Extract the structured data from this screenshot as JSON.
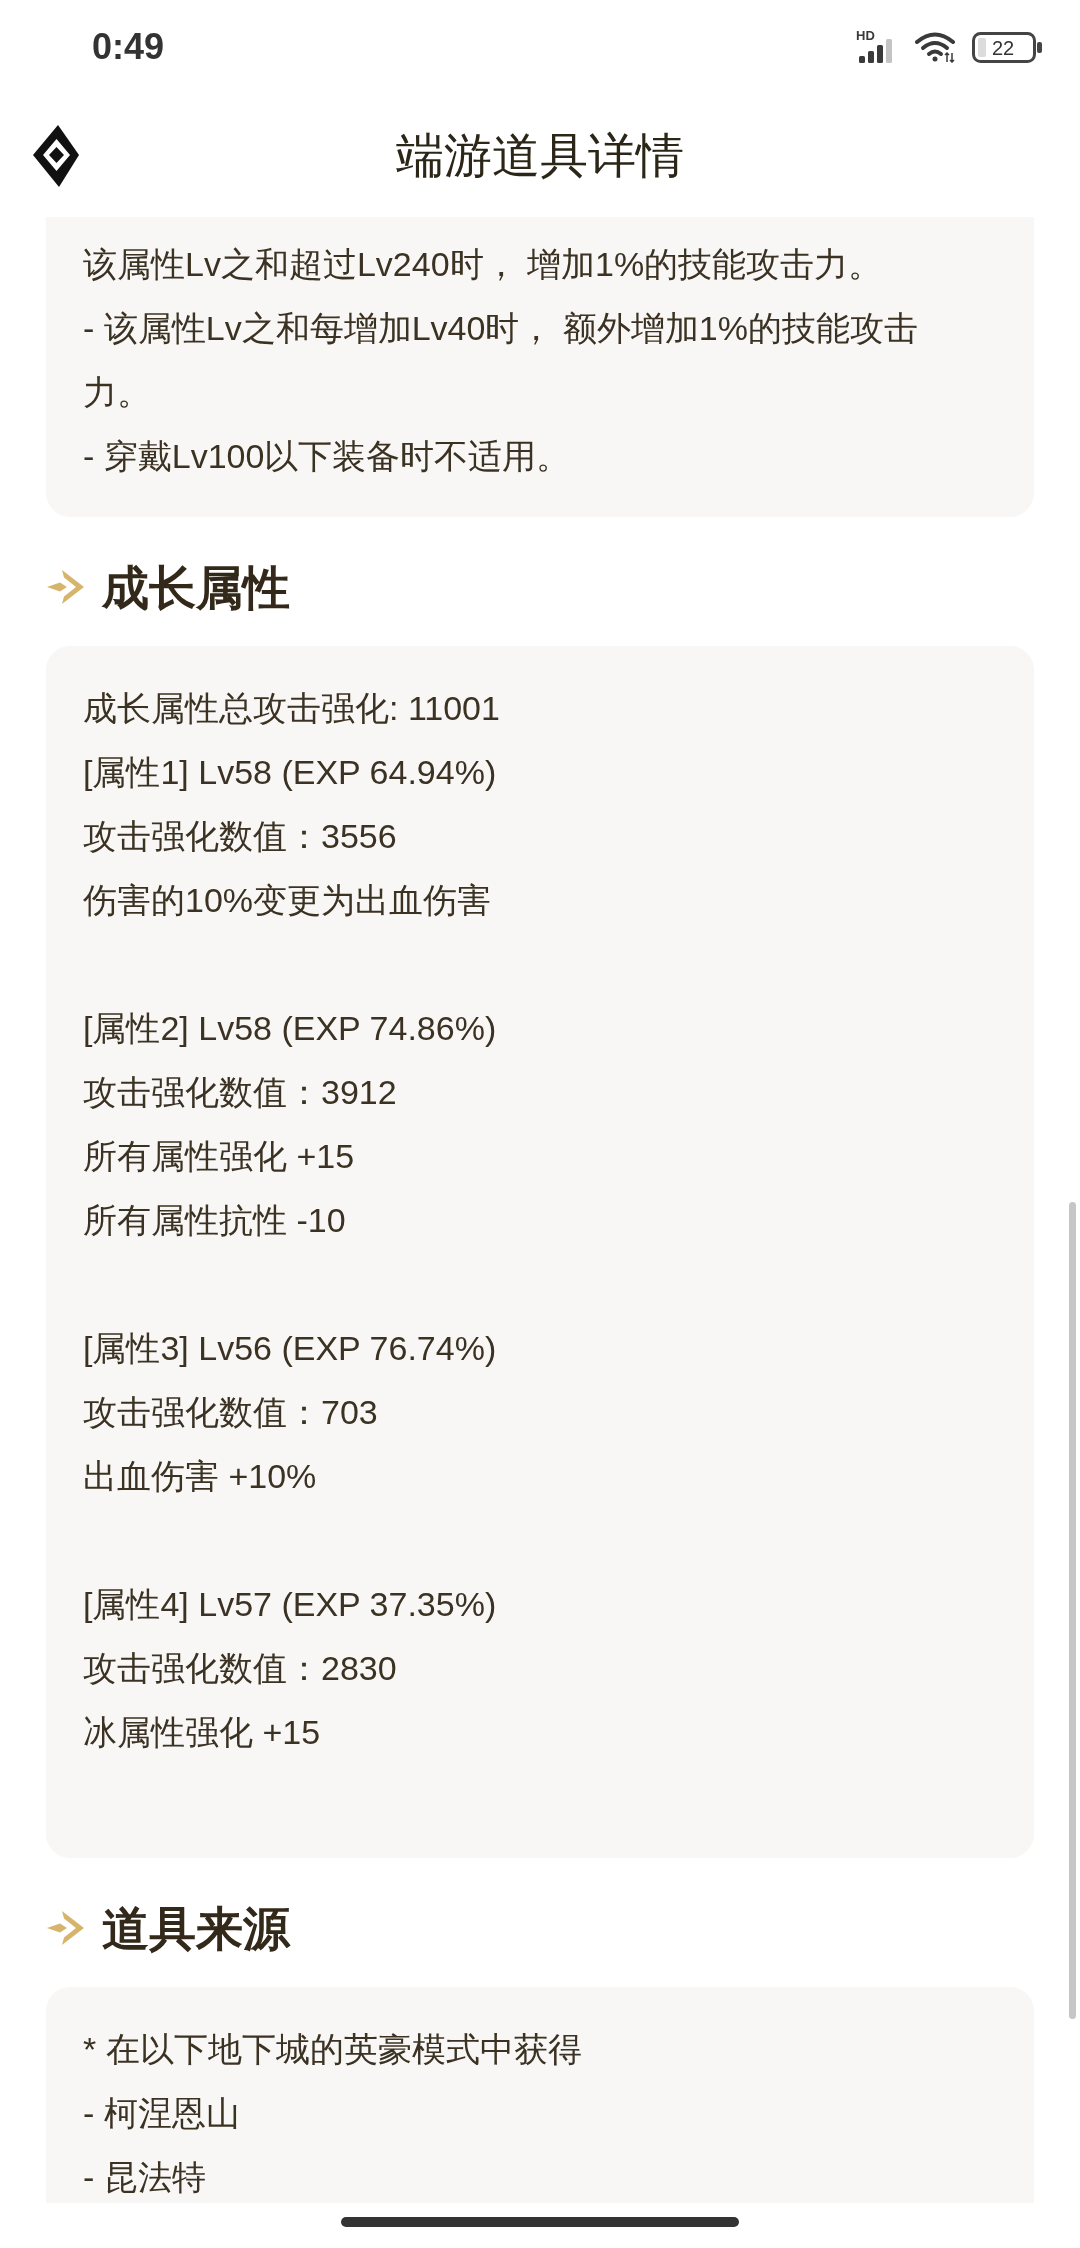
{
  "status_bar": {
    "time": "0:49",
    "network_type": "HD",
    "battery": "22"
  },
  "header": {
    "title": "端游道具详情"
  },
  "description_card": {
    "lines": [
      "该属性Lv之和超过Lv240时， 增加1%的技能攻击力。",
      "- 该属性Lv之和每增加Lv40时， 额外增加1%的技能攻击力。",
      "- 穿戴Lv100以下装备时不适用。"
    ]
  },
  "sections": [
    {
      "kind": "growth",
      "title": "成长属性",
      "total": "成长属性总攻击强化: 11001",
      "attributes": [
        {
          "header": "[属性1] Lv58 (EXP 64.94%)",
          "lines": [
            "攻击强化数值：3556",
            "伤害的10%变更为出血伤害"
          ]
        },
        {
          "header": "[属性2] Lv58 (EXP 74.86%)",
          "lines": [
            "攻击强化数值：3912",
            "所有属性强化 +15",
            "所有属性抗性 -10"
          ]
        },
        {
          "header": "[属性3] Lv56 (EXP 76.74%)",
          "lines": [
            "攻击强化数值：703",
            "出血伤害 +10%"
          ]
        },
        {
          "header": "[属性4] Lv57 (EXP 37.35%)",
          "lines": [
            "攻击强化数值：2830",
            "冰属性强化 +15"
          ]
        }
      ]
    },
    {
      "kind": "text",
      "title": "道具来源",
      "lines": [
        "* 在以下地下城的英豪模式中获得",
        "- 柯涅恩山",
        "- 昆法特"
      ]
    }
  ]
}
